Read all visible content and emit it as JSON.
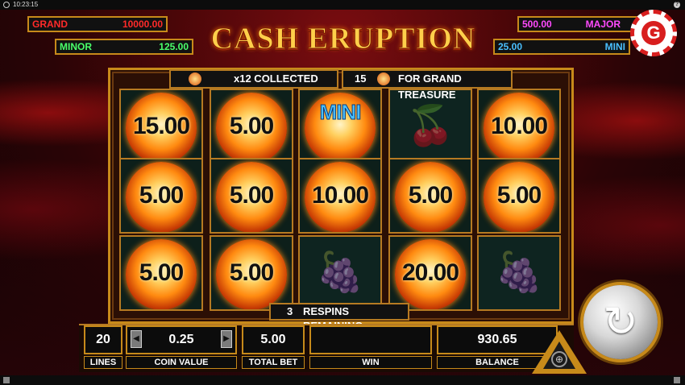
{
  "status": {
    "time": "10:23:15"
  },
  "title": "CASH ERUPTION",
  "jackpots": {
    "grand": {
      "label": "GRAND",
      "value": "10000.00",
      "color": "#ff2a2a"
    },
    "minor": {
      "label": "MINOR",
      "value": "125.00",
      "color": "#4aff6a"
    },
    "major": {
      "label": "MAJOR",
      "value": "500.00",
      "color": "#ff4aff"
    },
    "mini": {
      "label": "MINI",
      "value": "25.00",
      "color": "#4ac0ff"
    }
  },
  "collected": {
    "text": "x12 COLLECTED"
  },
  "grand_treasure": {
    "count": "15",
    "text": "FOR GRAND TREASURE"
  },
  "reels": {
    "r0": [
      "15.00",
      "5.00",
      "MINI",
      "cherry",
      "10.00"
    ],
    "r1": [
      "5.00",
      "5.00",
      "10.00",
      "5.00",
      "5.00"
    ],
    "r2": [
      "5.00",
      "5.00",
      "grape",
      "20.00",
      "grape"
    ]
  },
  "respins": {
    "count": "3",
    "text": "RESPINS REMAINING"
  },
  "bottom": {
    "lines": {
      "value": "20",
      "label": "LINES"
    },
    "coin_value": {
      "value": "0.25",
      "label": "COIN VALUE"
    },
    "total_bet": {
      "value": "5.00",
      "label": "TOTAL BET"
    },
    "win": {
      "value": "",
      "label": "WIN"
    },
    "balance": {
      "value": "930.65",
      "label": "BALANCE"
    }
  },
  "logo": {
    "letter": "G"
  },
  "icons": [
    "clock-icon",
    "help-icon",
    "settings-icon",
    "spin-icon",
    "cherry-icon",
    "grape-icon"
  ]
}
